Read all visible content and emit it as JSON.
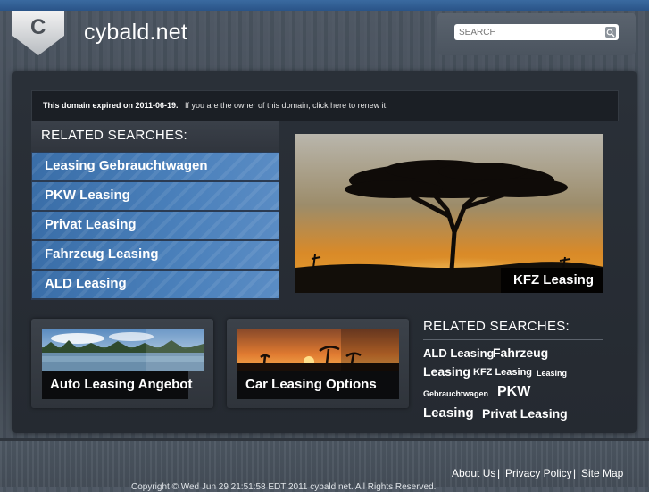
{
  "site": {
    "logo_letter": "C",
    "title": "cybald.net"
  },
  "search": {
    "placeholder": "SEARCH"
  },
  "notice": {
    "bold": "This domain expired on 2011-06-19.",
    "text": "If you are the owner of this domain, click here to renew it."
  },
  "related": {
    "title": "RELATED SEARCHES:",
    "items": [
      "Leasing Gebrauchtwagen",
      "PKW Leasing",
      "Privat Leasing",
      "Fahrzeug Leasing",
      "ALD Leasing"
    ]
  },
  "hero": {
    "label": "KFZ Leasing"
  },
  "tiles": [
    {
      "label": "Auto Leasing Angebot"
    },
    {
      "label": "Car Leasing Options"
    }
  ],
  "side": {
    "title": "RELATED SEARCHES:",
    "tags": [
      "ALD Leasing",
      "Fahrzeug",
      "Leasing",
      "KFZ Leasing",
      "Leasing",
      "Gebrauchtwagen",
      "PKW",
      "Leasing",
      "Privat Leasing"
    ]
  },
  "footer": {
    "links": [
      "About Us",
      "Privacy Policy",
      "Site Map"
    ],
    "separator": "|",
    "copyright": "Copyright © Wed Jun 29 21:51:58 EDT 2011 cybald.net. All Rights Reserved."
  },
  "colors": {
    "accent_blue": "#3a6ea8",
    "topbar": "#2a5488",
    "panel": "#252a31"
  }
}
